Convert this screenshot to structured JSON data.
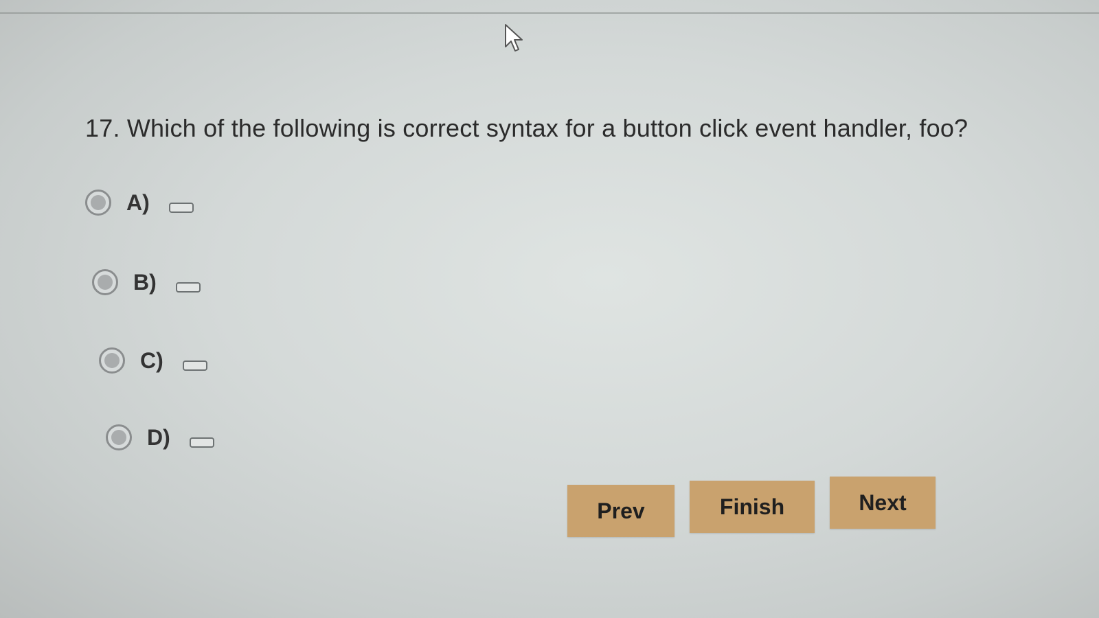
{
  "question": {
    "text": "17. Which of the following is correct syntax for a button click event handler, foo?"
  },
  "options": [
    {
      "label": "A)"
    },
    {
      "label": "B)"
    },
    {
      "label": "C)"
    },
    {
      "label": "D)"
    }
  ],
  "buttons": {
    "prev": "Prev",
    "finish": "Finish",
    "next": "Next"
  },
  "colors": {
    "button_bg": "#c9a26e",
    "background": "#d4d9d8"
  },
  "icons": {
    "cursor": "mouse-pointer-icon"
  }
}
